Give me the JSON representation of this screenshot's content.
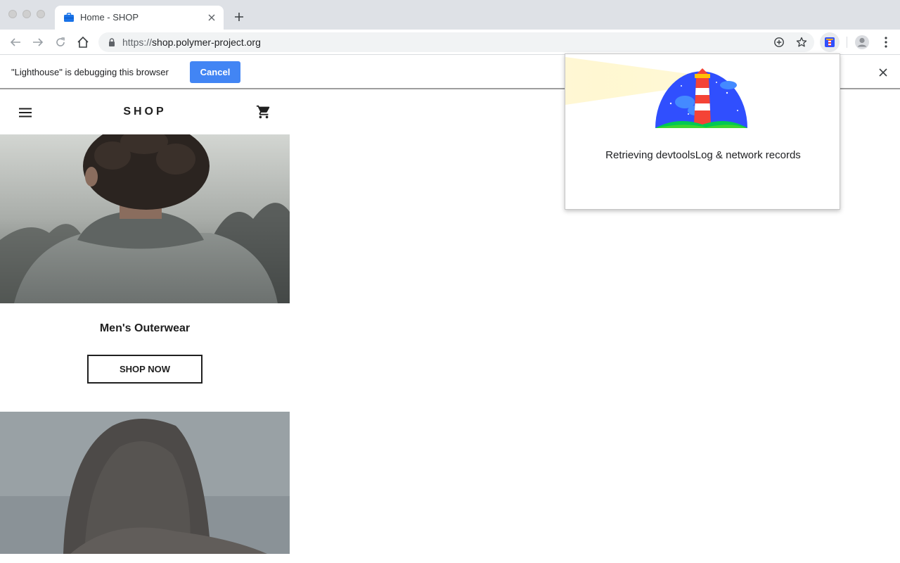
{
  "window": {
    "tab": {
      "title": "Home - SHOP"
    }
  },
  "toolbar": {
    "url_scheme": "https://",
    "url_host": "shop.polymer-project.org"
  },
  "infobar": {
    "message": "\"Lighthouse\" is debugging this browser",
    "cancel_label": "Cancel"
  },
  "shop": {
    "logo": "SHOP",
    "category": "Men's Outerwear",
    "cta_label": "SHOP NOW"
  },
  "lighthouse_popup": {
    "status": "Retrieving devtoolsLog & network records"
  },
  "colors": {
    "accent_blue": "#4285f4",
    "chrome_frame": "#dee1e6",
    "lighthouse_sky": "#304ffe"
  },
  "icons": [
    "briefcase-favicon-icon",
    "close-icon",
    "plus-icon",
    "back-icon",
    "forward-icon",
    "reload-icon",
    "home-icon",
    "lock-icon",
    "add-circle-icon",
    "star-icon",
    "lighthouse-extension-icon",
    "account-icon",
    "more-vert-icon",
    "menu-icon",
    "cart-icon"
  ]
}
